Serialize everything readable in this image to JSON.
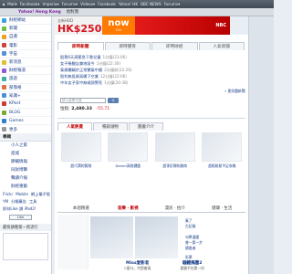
{
  "bookmarks": [
    "Mail▾",
    "Facebook▾",
    "Imperia▾",
    "Forums▾",
    "Videos▾",
    "Facebook",
    "Yahoo! HK",
    "BBC NEWS",
    "Forums▾"
  ],
  "tabbar": {
    "brand": "Yahoo! Hong Kong",
    "tab2": "他對我"
  },
  "banner": {
    "pre": "全新HDD",
    "price": "HK$250",
    "now_big": "now",
    "now_small": "101",
    "logo": "NBC"
  },
  "sidebar": {
    "items": [
      {
        "label": "財經網站",
        "color": "#3aa1e0"
      },
      {
        "label": "新聞",
        "color": "#6fbf4a"
      },
      {
        "label": "自選",
        "color": "#f0a020"
      },
      {
        "label": "電影",
        "color": "#d04040"
      },
      {
        "label": "宇宙",
        "color": "#5a8fd4"
      },
      {
        "label": "新消息",
        "color": "#e0c030"
      },
      {
        "label": "財經報道",
        "color": "#8e5bd0"
      },
      {
        "label": "旅遊",
        "color": "#3fb0a0"
      },
      {
        "label": "部落格",
        "color": "#e07040"
      },
      {
        "label": "知識+",
        "color": "#4a90d9"
      },
      {
        "label": "KPost",
        "color": "#cf3a3a"
      },
      {
        "label": "BLOG",
        "color": "#7aaa30"
      },
      {
        "label": "Games",
        "color": "#2f80c4"
      },
      {
        "label": "更多",
        "color": "#999999"
      }
    ],
    "section_title": "專輯",
    "subs": [
      "小人之家",
      "進城",
      "節輔情報",
      "同財博聲",
      "聲讀介報",
      "財經重藝"
    ],
    "links": [
      "Flickr",
      "Mobile",
      "網上電子版",
      "YM",
      "分類廣告",
      "工具"
    ],
    "like_row": "即刻Like 讚 iPad2!",
    "like_btn": "Like",
    "quest_head": "最快請看第一頁流行"
  },
  "main": {
    "tabs": [
      "即時新聞",
      "即時體育",
      "即時財經",
      "人氣新聞"
    ],
    "news": [
      {
        "text": "股票6天高緊急下跌兒童",
        "when": "1分鐘(23:06)"
      },
      {
        "text": "女子捲臘店兼地區今",
        "when": "1分鐘(22:30)"
      },
      {
        "text": "泰鋼價輛於正常繁榮中國",
        "when": "2分鐘前(22:26)"
      },
      {
        "text": "股利無投資高價下空業",
        "when": "12分鐘(22:06)"
      },
      {
        "text": "中年女子家中無端頂警死",
        "when": "1分鐘(20:38)"
      }
    ],
    "more": "» 更詳盡新聞",
    "search_placeholder": "請入股票代號",
    "search_btn": "Q",
    "index_label": "恒指:",
    "index_value": "2,480.33",
    "index_change": "-55.71",
    "box2_tabs": [
      "人氣熱賣",
      "暢銷潮物",
      "圖書介介"
    ],
    "thumbs": [
      "超巧潤的緊閉",
      "Denim高挑擺鹿",
      "超專反轉折腳商",
      "超鬆鬆鬆平足攻略"
    ],
    "box3_tabs": [
      "本週精選",
      "音樂 · 影視",
      "漫訊 · 拾介",
      "健康 · 生活"
    ],
    "box3_right": [
      "棄了",
      "古記服",
      "句學溫暖",
      "曾一第一步",
      "讀書者",
      "彩票",
      "經日行名"
    ],
    "caps": [
      {
        "title": "Miss愛影者",
        "sub": "C星口，代價會兩"
      },
      {
        "title": "騷聽風雲2",
        "sub": "星國不在第一份"
      }
    ]
  }
}
